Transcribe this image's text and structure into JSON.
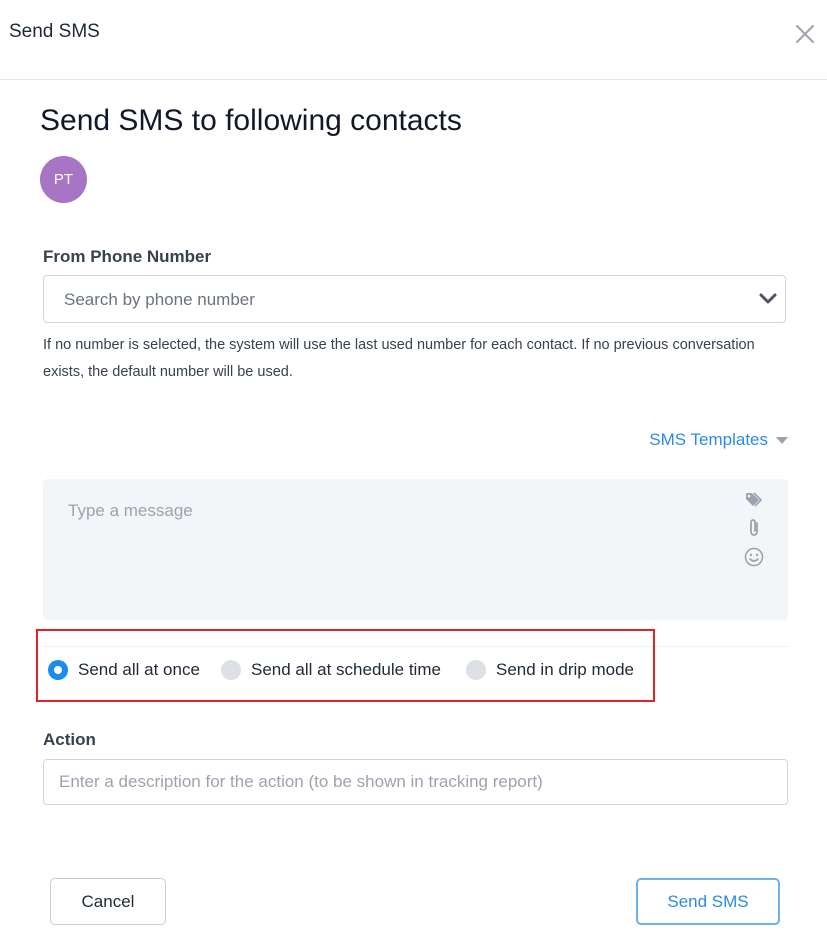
{
  "header": {
    "title": "Send SMS",
    "close_icon": "close-icon"
  },
  "main": {
    "title": "Send SMS to following contacts",
    "contacts": [
      {
        "initials": "PT",
        "avatar_color": "#a875c4"
      }
    ]
  },
  "from_phone": {
    "label": "From Phone Number",
    "placeholder": "Search by phone number",
    "help_text": "If no number is selected, the system will use the last used number for each contact. If no previous conversation exists, the default number will be used."
  },
  "templates": {
    "label": "SMS Templates"
  },
  "message": {
    "placeholder": "Type a message",
    "icons": [
      "tag-icon",
      "paperclip-icon",
      "emoji-icon"
    ]
  },
  "send_mode": {
    "options": [
      {
        "label": "Send all at once",
        "checked": true
      },
      {
        "label": "Send all at schedule time",
        "checked": false
      },
      {
        "label": "Send in drip mode",
        "checked": false
      }
    ],
    "highlight_color": "#dc2626"
  },
  "action": {
    "label": "Action",
    "placeholder": "Enter a description for the action (to be shown in tracking report)",
    "value": ""
  },
  "footer": {
    "cancel_label": "Cancel",
    "send_label": "Send SMS"
  },
  "colors": {
    "accent": "#2b8be6",
    "radio_checked": "#1a8cf0"
  }
}
